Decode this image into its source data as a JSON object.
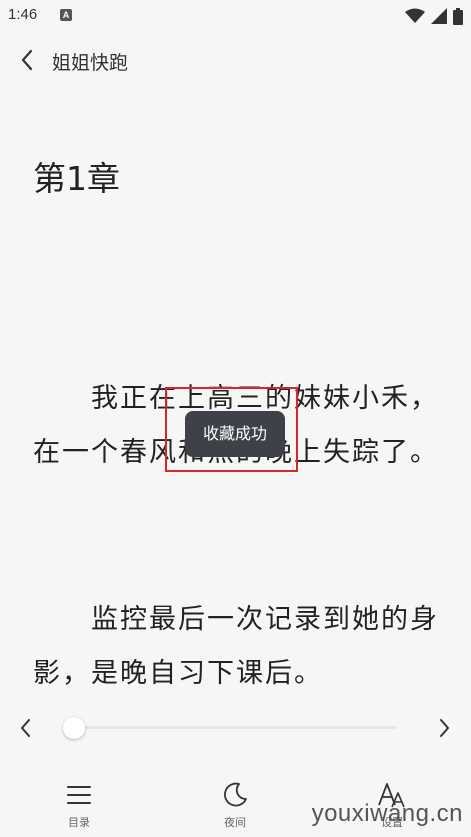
{
  "status_bar": {
    "time": "1:46",
    "notification_glyph": "A",
    "icons": [
      "wifi-icon",
      "signal-icon",
      "battery-icon"
    ]
  },
  "header": {
    "back_icon": "chevron-left-icon",
    "title": "姐姐快跑"
  },
  "content": {
    "chapter_title": "第1章",
    "paragraphs": [
      "我正在上高三的妹妹小禾，在一个春风和煦的晚上失踪了。",
      "监控最后一次记录到她的身影，是晚自习下课后。"
    ]
  },
  "toast": {
    "message": "收藏成功",
    "highlight_color": "#d9262c"
  },
  "progress": {
    "prev_icon": "chevron-left-icon",
    "next_icon": "chevron-right-icon",
    "value": 0.03
  },
  "toolbar": {
    "items": [
      {
        "label": "目录",
        "icon": "menu-list-icon"
      },
      {
        "label": "夜间",
        "icon": "moon-icon"
      },
      {
        "label": "设置",
        "icon": "font-size-icon"
      }
    ]
  },
  "watermark": "youxiwang.cn",
  "colors": {
    "background": "#f6f6f6",
    "toast_bg": "#3e4148",
    "text": "#222222"
  }
}
